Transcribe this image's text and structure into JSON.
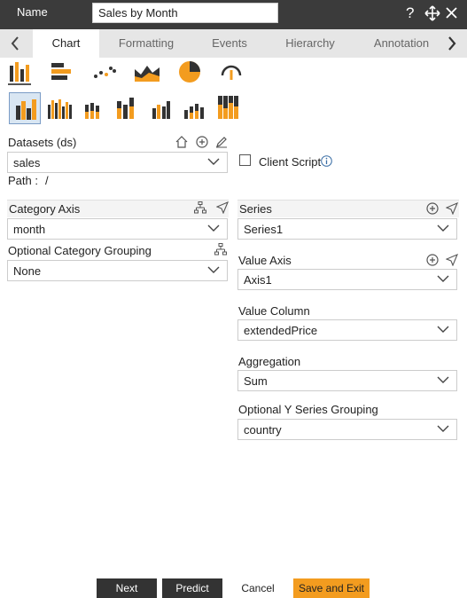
{
  "header": {
    "name_label": "Name",
    "name_value": "Sales by Month",
    "help_icon": "?",
    "move_icon": "move-icon",
    "close_icon": "close-icon"
  },
  "tabs": [
    {
      "label": "Chart",
      "active": true
    },
    {
      "label": "Formatting"
    },
    {
      "label": "Events"
    },
    {
      "label": "Hierarchy"
    },
    {
      "label": "Annotation"
    }
  ],
  "chart_types": [
    "bar-chart-icon",
    "horizontal-bar-icon",
    "scatter-icon",
    "area-chart-icon",
    "pie-chart-icon",
    "gauge-icon"
  ],
  "subtypes": [
    "clustered",
    "grouped-multi",
    "stacked",
    "stacked-tall",
    "grouped-small",
    "stacked-small",
    "stacked-100"
  ],
  "datasets": {
    "label": "Datasets (ds)",
    "value": "sales",
    "path_label": "Path :",
    "path_value": "/"
  },
  "client_script": {
    "label": "Client Script",
    "checked": false
  },
  "category_axis": {
    "label": "Category Axis",
    "value": "month"
  },
  "category_grouping": {
    "label": "Optional Category Grouping",
    "value": "None"
  },
  "series": {
    "label": "Series",
    "value": "Series1"
  },
  "value_axis": {
    "label": "Value Axis",
    "value": "Axis1"
  },
  "value_column": {
    "label": "Value Column",
    "value": "extendedPrice"
  },
  "aggregation": {
    "label": "Aggregation",
    "value": "Sum"
  },
  "y_grouping": {
    "label": "Optional Y Series Grouping",
    "value": "country"
  },
  "buttons": {
    "next": "Next",
    "predict": "Predict",
    "cancel": "Cancel",
    "save_exit": "Save and Exit"
  },
  "colors": {
    "accent": "#f39c1f",
    "header_bg": "#3b3b3b",
    "button_dark": "#333333"
  }
}
